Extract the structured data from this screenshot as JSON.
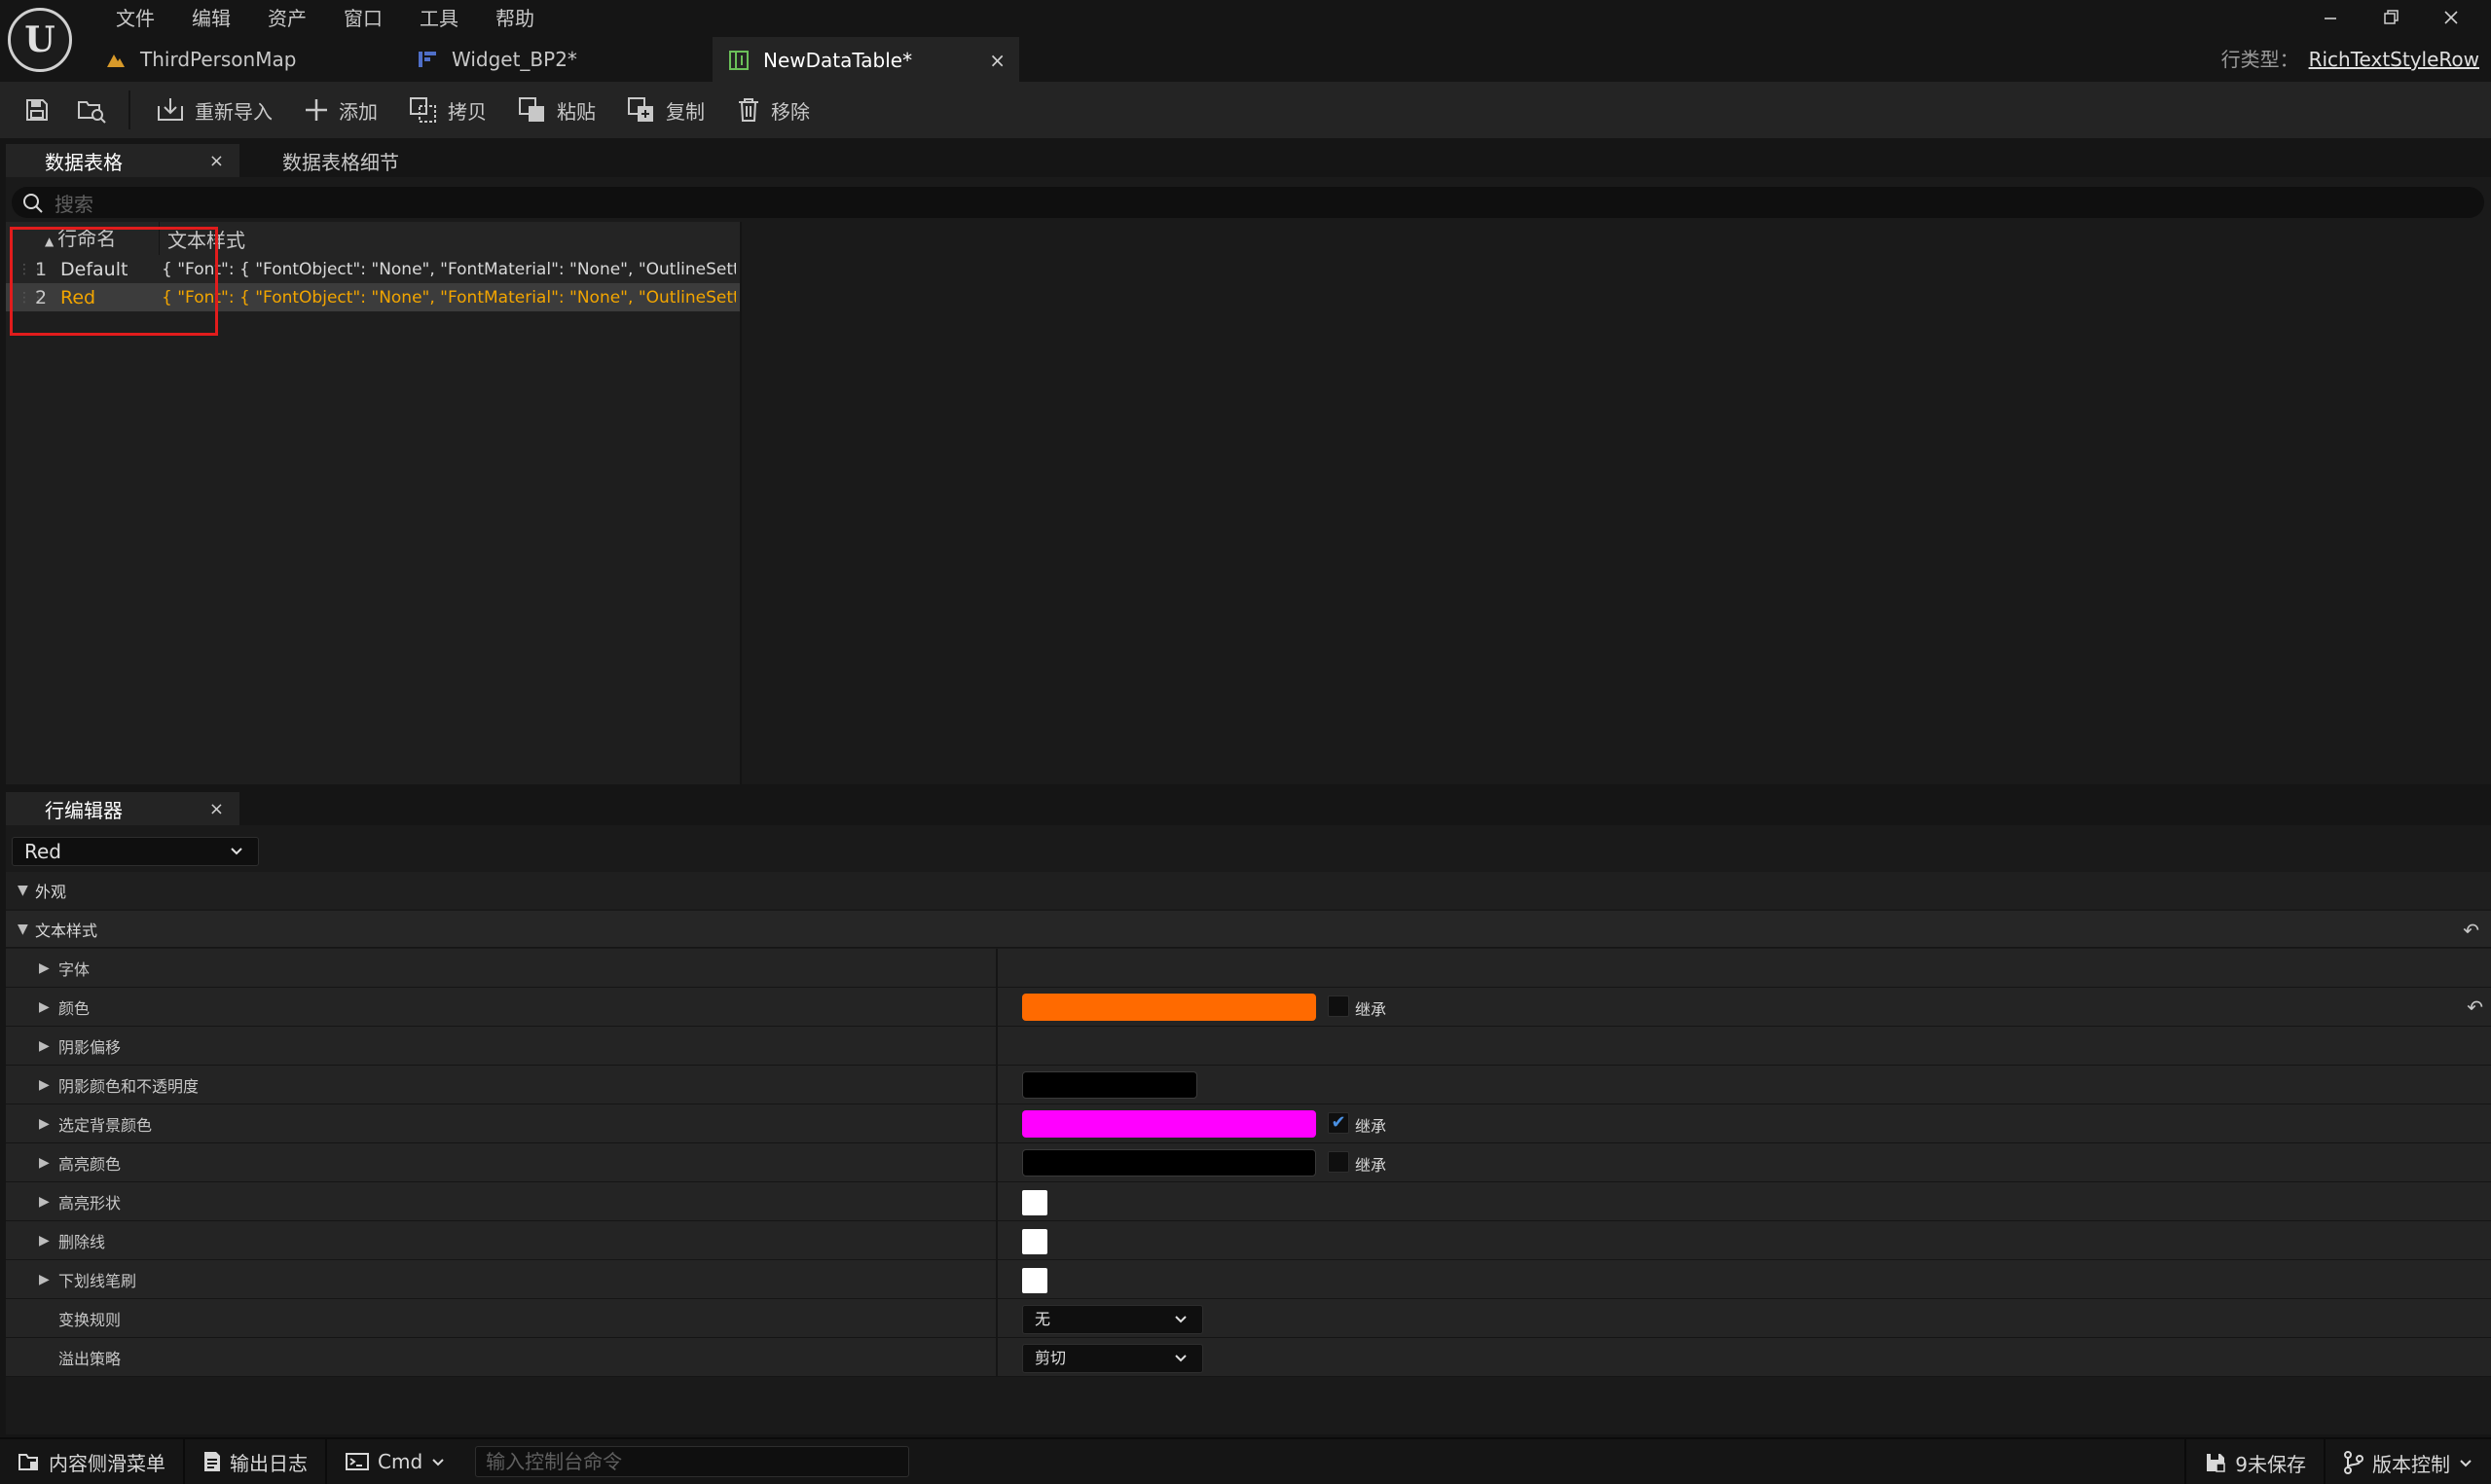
{
  "menu": [
    "文件",
    "编辑",
    "资产",
    "窗口",
    "工具",
    "帮助"
  ],
  "doc_tabs": [
    {
      "label": "ThirdPersonMap",
      "icon": "level-icon"
    },
    {
      "label": "Widget_BP2*",
      "icon": "widget-blueprint-icon"
    },
    {
      "label": "NewDataTable*",
      "icon": "data-table-icon",
      "close": "×"
    }
  ],
  "row_type": {
    "label": "行类型：",
    "value": "RichTextStyleRow"
  },
  "toolbar": {
    "reimport": "重新导入",
    "add": "添加",
    "copy": "拷贝",
    "paste": "粘贴",
    "duplicate": "复制",
    "remove": "移除"
  },
  "data_table_panel": {
    "tabs": [
      {
        "label": "数据表格",
        "close": "×"
      },
      {
        "label": "数据表格细节"
      }
    ],
    "search_placeholder": "搜索",
    "columns": [
      "行命名",
      "文本样式"
    ],
    "rows": [
      {
        "num": "1",
        "name": "Default",
        "value": "{ \"Font\": { \"FontObject\": \"None\", \"FontMaterial\": \"None\", \"OutlineSettings\": {"
      },
      {
        "num": "2",
        "name": "Red",
        "value": "{ \"Font\": { \"FontObject\": \"None\", \"FontMaterial\": \"None\", \"OutlineSettings\": {"
      }
    ]
  },
  "row_editor": {
    "tab": {
      "label": "行编辑器",
      "close": "×"
    },
    "selected_row": "Red",
    "categories": {
      "appearance": "外观",
      "text_style": "文本样式"
    },
    "properties": [
      {
        "label": "字体"
      },
      {
        "label": "颜色",
        "color": "#FF6A00",
        "inherit_label": "继承",
        "inherit_checked": false
      },
      {
        "label": "阴影偏移"
      },
      {
        "label": "阴影颜色和不透明度",
        "color": "#000000"
      },
      {
        "label": "选定背景颜色",
        "color": "#FF00FF",
        "inherit_label": "继承",
        "inherit_checked": true
      },
      {
        "label": "高亮颜色",
        "color": "#000000",
        "inherit_label": "继承",
        "inherit_checked": false
      },
      {
        "label": "高亮形状"
      },
      {
        "label": "删除线"
      },
      {
        "label": "下划线笔刷"
      },
      {
        "label": "变换规则",
        "value": "无"
      },
      {
        "label": "溢出策略",
        "value": "剪切"
      }
    ]
  },
  "statusbar": {
    "content_drawer": "内容侧滑菜单",
    "output_log": "输出日志",
    "cmd": "Cmd",
    "console_placeholder": "输入控制台命令",
    "unsaved": "9未保存",
    "source_control": "版本控制"
  },
  "colors": {
    "accent_orange": "#F2A500",
    "highlight_red": "#E11C1C",
    "checkbox_blue": "#4A90E2"
  }
}
